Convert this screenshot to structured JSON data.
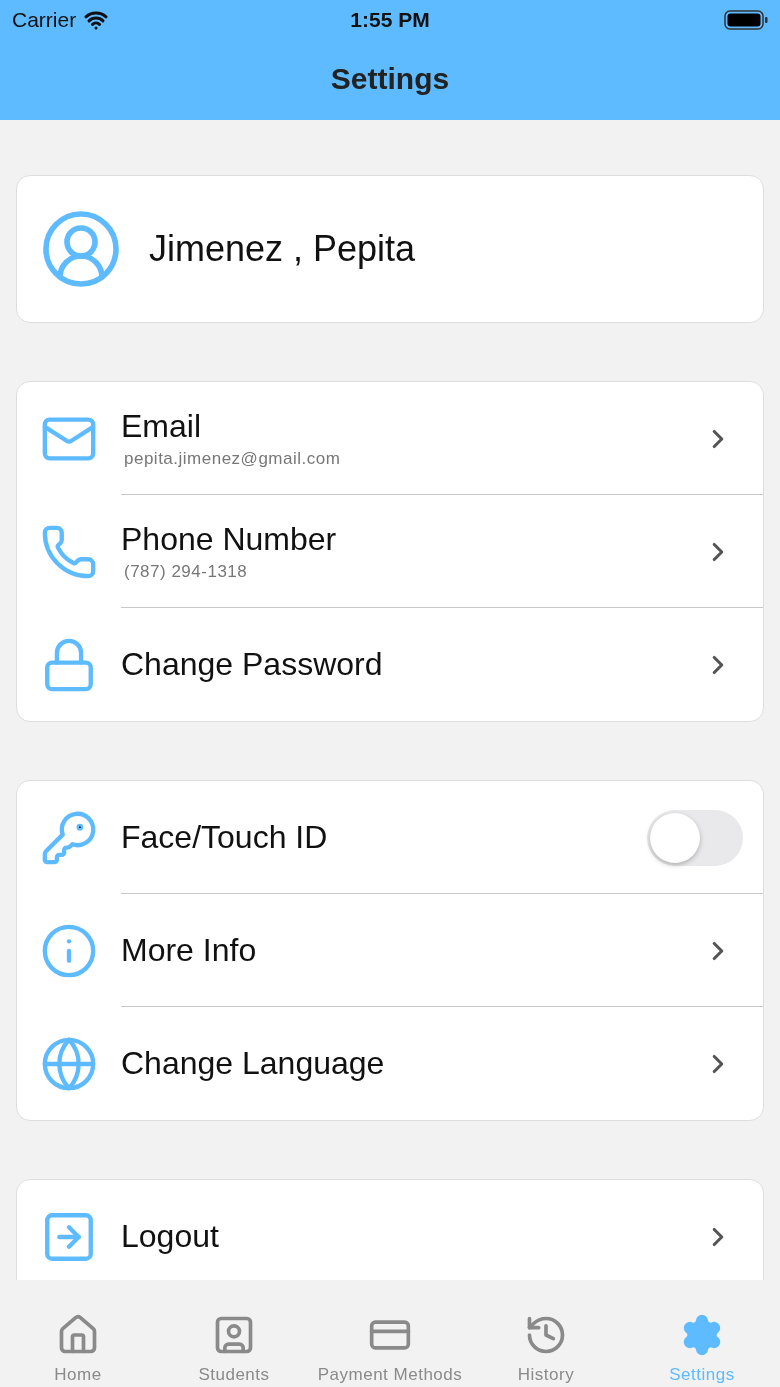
{
  "status_bar": {
    "carrier": "Carrier",
    "time": "1:55 PM"
  },
  "nav": {
    "title": "Settings"
  },
  "profile": {
    "name": "Jimenez , Pepita"
  },
  "sections": [
    {
      "rows": [
        {
          "kind": "nav",
          "title": "Email",
          "subtitle": "pepita.jimenez@gmail.com"
        },
        {
          "kind": "nav",
          "title": "Phone Number",
          "subtitle": "(787) 294-1318"
        },
        {
          "kind": "nav",
          "title": "Change Password"
        }
      ]
    },
    {
      "rows": [
        {
          "kind": "toggle",
          "title": "Face/Touch ID",
          "on": false
        },
        {
          "kind": "nav",
          "title": "More Info"
        },
        {
          "kind": "nav",
          "title": "Change Language"
        }
      ]
    },
    {
      "rows": [
        {
          "kind": "nav",
          "title": "Logout"
        }
      ]
    }
  ],
  "tabs": [
    {
      "label": "Home",
      "selected": false
    },
    {
      "label": "Students",
      "selected": false
    },
    {
      "label": "Payment Methods",
      "selected": false
    },
    {
      "label": "History",
      "selected": false
    },
    {
      "label": "Settings",
      "selected": true
    }
  ]
}
